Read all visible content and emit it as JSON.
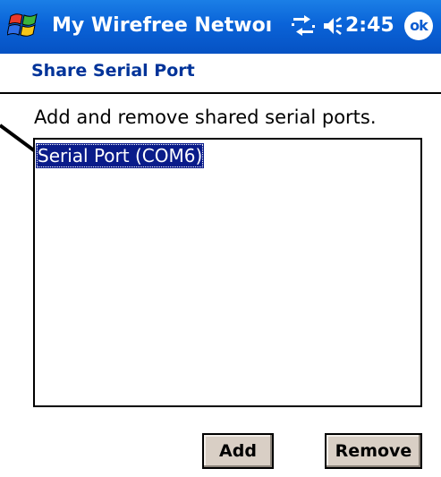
{
  "window": {
    "title": "My Wirefree Netwoı",
    "clock": "2:45",
    "ok_label": "ok",
    "start_icon": "windows-flag-icon",
    "network_icon": "network-connection-icon",
    "volume_icon": "speaker-volume-icon"
  },
  "header": {
    "title": "Share Serial Port"
  },
  "main": {
    "instruction": "Add and remove shared serial ports.",
    "list": {
      "items": [
        {
          "label": "Serial Port (COM6)",
          "selected": true
        }
      ]
    }
  },
  "buttons": {
    "add_label": "Add",
    "remove_label": "Remove"
  },
  "colors": {
    "titlebar": "#0a63d8",
    "header_text": "#003399",
    "selection": "#0a1c8a",
    "button_face": "#d9cfc5"
  }
}
